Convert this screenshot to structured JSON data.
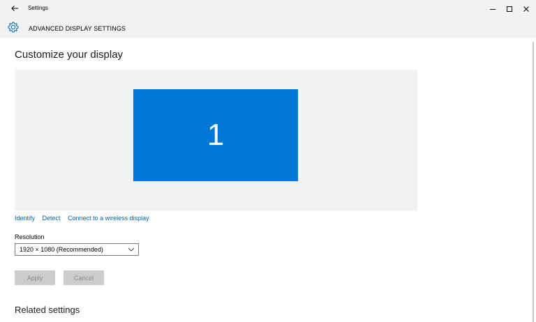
{
  "window": {
    "title": "Settings",
    "minimize_glyph": "–",
    "maximize_glyph": "☐",
    "close_glyph": "✕"
  },
  "header": {
    "icon": "gear-icon",
    "title": "ADVANCED DISPLAY SETTINGS"
  },
  "main": {
    "title": "Customize your display",
    "display": {
      "monitor_number": "1",
      "accent_color": "#0078d7",
      "area_color": "#f2f2f2"
    },
    "links": {
      "identify": "Identify",
      "detect": "Detect",
      "wireless": "Connect to a wireless display"
    },
    "resolution": {
      "label": "Resolution",
      "selected": "1920 × 1080 (Recommended)"
    },
    "buttons": {
      "apply": "Apply",
      "cancel": "Cancel"
    },
    "related_title": "Related settings"
  }
}
